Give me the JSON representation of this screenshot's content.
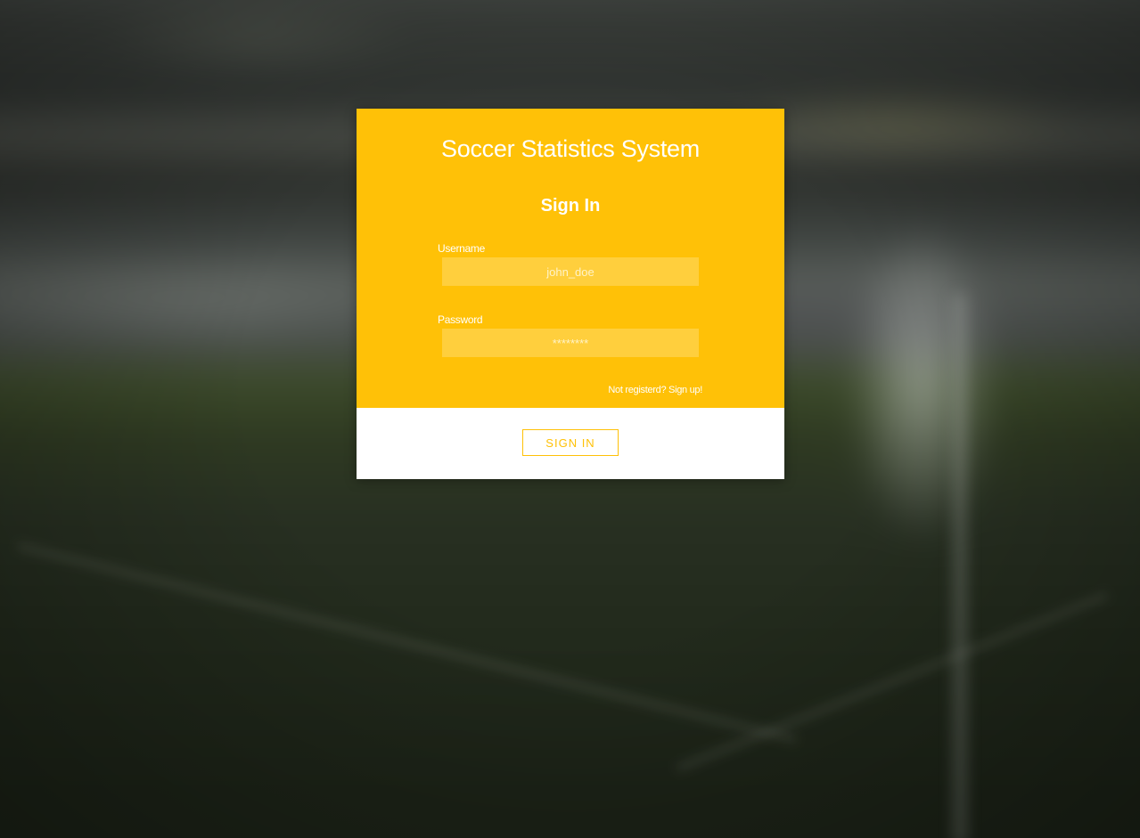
{
  "colors": {
    "accent": "#ffc107",
    "input_bg": "#ffcf3d",
    "card_bottom": "#ffffff",
    "text_on_accent": "#ffffff"
  },
  "background": {
    "description_icon": "stadium-background-image"
  },
  "login": {
    "app_title": "Soccer Statistics System",
    "form_title": "Sign In",
    "username": {
      "label": "Username",
      "placeholder": "john_doe",
      "value": ""
    },
    "password": {
      "label": "Password",
      "placeholder": "********",
      "value": ""
    },
    "signup_link": "Not registerd? Sign up!",
    "submit_label": "SIGN IN"
  }
}
